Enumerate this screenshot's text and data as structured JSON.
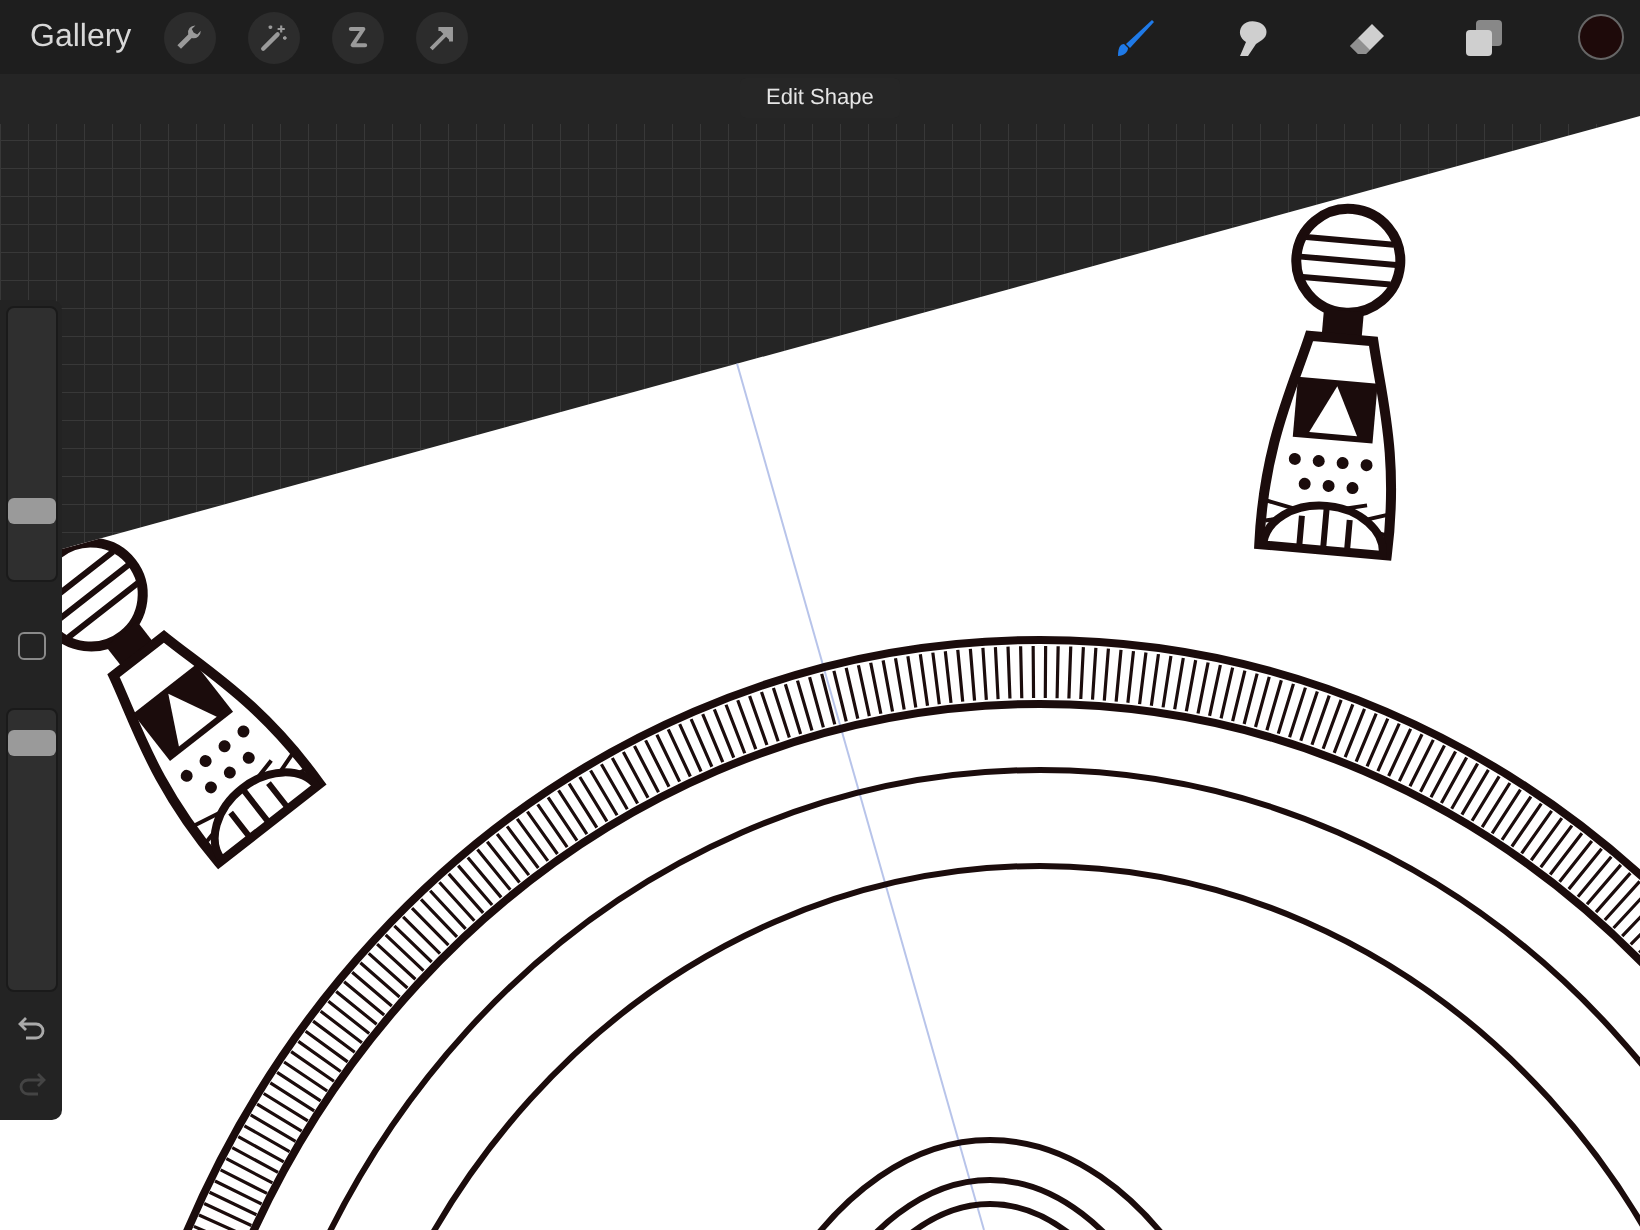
{
  "top_bar": {
    "gallery": "Gallery",
    "actions": [
      {
        "kind": "wrench"
      },
      {
        "kind": "wand"
      },
      {
        "kind": "selection"
      },
      {
        "kind": "transform"
      }
    ],
    "tools": [
      {
        "kind": "brush",
        "selected": true
      },
      {
        "kind": "smudge",
        "selected": false
      },
      {
        "kind": "eraser",
        "selected": false
      },
      {
        "kind": "layers",
        "selected": false
      }
    ],
    "color": "#1e0a0a"
  },
  "mode_label": "Edit Shape",
  "sidebar": {
    "size_slider": {
      "level": 0.23
    },
    "opacity_slider": {
      "level": 0.92
    },
    "undo": {
      "disabled": false
    },
    "redo": {
      "disabled": true
    }
  }
}
